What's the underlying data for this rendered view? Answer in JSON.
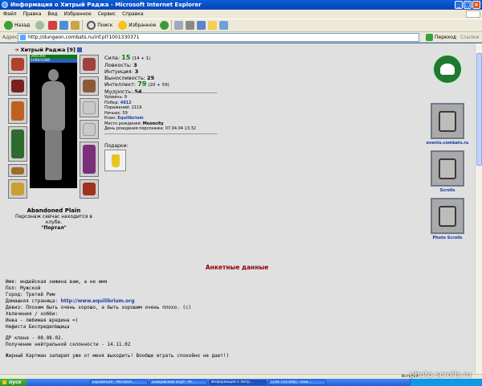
{
  "window": {
    "title": "Информация о Хитрый Раджа - Microsoft Internet Explorer"
  },
  "menu": [
    "Файл",
    "Правка",
    "Вид",
    "Избранное",
    "Сервис",
    "Справка"
  ],
  "toolbar": {
    "back": "Назад",
    "search": "Поиск",
    "favorites": "Избранное"
  },
  "address": {
    "label": "Адрес:",
    "url": "http://dungeon.combats.ru/inf.pl?1001330371",
    "go": "Переход",
    "links": "Ссылки"
  },
  "character": {
    "name": "Хитрый Раджа",
    "level_tag": "[9]",
    "hp_text": "390/390",
    "mp_text": "1080/1080",
    "location_name": "Abandoned Plain",
    "location_text": "Персонаж сейчас находится в клубе.",
    "room": "\"Портал\""
  },
  "stats": [
    {
      "label": "Сила:",
      "value": "15",
      "bonus": "(14 + 1)",
      "green": true
    },
    {
      "label": "Ловкость:",
      "value": "3",
      "bonus": "",
      "green": false
    },
    {
      "label": "Интуиция:",
      "value": "3",
      "bonus": "",
      "green": false
    },
    {
      "label": "Выносливость:",
      "value": "25",
      "bonus": "",
      "green": false
    },
    {
      "label": "Интеллект:",
      "value": "79",
      "bonus": "(20 + 59)",
      "green": true
    },
    {
      "label": "Мудрость:",
      "value": "54",
      "bonus": "",
      "green": false
    }
  ],
  "info": {
    "level_label": "Уровень:",
    "level": "9",
    "wins_label": "Побед:",
    "wins": "4812",
    "losses_label": "Поражений:",
    "losses": "2119",
    "draws_label": "Ничьих:",
    "draws": "59",
    "clan_label": "Клан:",
    "clan": "Equilibrium",
    "birthplace_label": "Место рождения:",
    "birthplace": "Mooncity",
    "birthday_label": "День рождения персонажа:",
    "birthday": "07.04.04 13:32"
  },
  "gifts_label": "Подарки:",
  "side_links": {
    "events": "events.combats.ru",
    "scrolls": "Scrolls",
    "photo_scrolls": "Photo Scrolls"
  },
  "anketa": {
    "title": "Анкетные данные",
    "name": "Имя: индейская хижина вам, а не имя",
    "gender": "Пол: Мужской",
    "city": "Город: Третий Рим",
    "homepage_label": "Домашняя страница:",
    "homepage": "http://www.equilibrium.org",
    "motto": "Девиз: Плохим быть очень хорошо, а быть хорошим очень плохо. (с)",
    "hobby_label": "Увлечения / хобби:",
    "hobby1": "Инва - любимая вредина =)",
    "hobby2": "Нефиста БеспределЬщица",
    "dr": "ДР клана - 08.08.02.",
    "neutral": "Получение нейтральной склонности - 14.11.02",
    "quote": "Жирный Картман запарил уже от меня выходить! Вообще играть спокойно не дает!)"
  },
  "status": {
    "zone": "Интернет"
  },
  "taskbar": {
    "start": "пуск",
    "tasks": [
      "Equilibrium - Microsof...",
      "Бойцовский клуб - M...",
      "Информация о Хитр...",
      "[230-725-406] - Они..."
    ]
  },
  "watermark": "photo.scrolls.ru",
  "colors": {
    "titlebar": "#0843b5",
    "content_bg": "#e0e0e0",
    "stat_green": "#0a7a0a",
    "anketa_title": "#8b0000",
    "link_blue": "#1b3fa8"
  }
}
